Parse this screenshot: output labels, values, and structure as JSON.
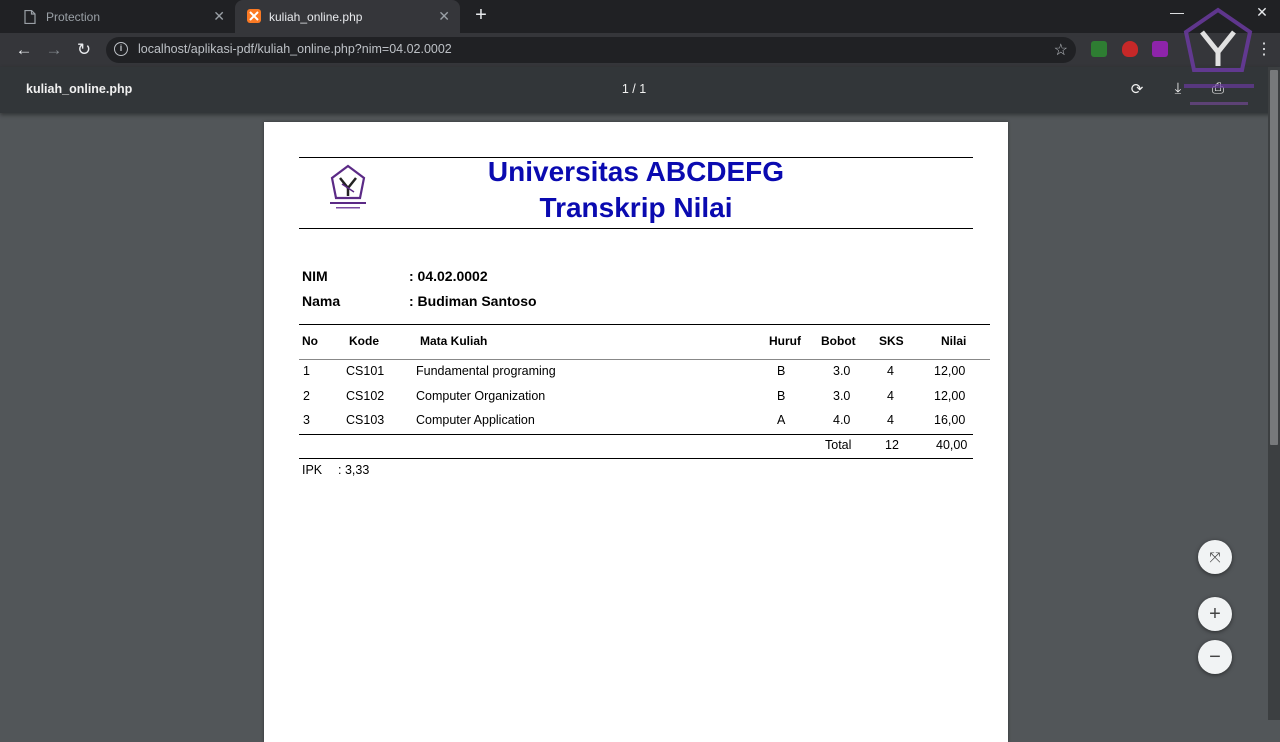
{
  "browser": {
    "tabs": [
      {
        "title": "Protection",
        "active": false
      },
      {
        "title": "kuliah_online.php",
        "active": true
      }
    ],
    "url": "localhost/aplikasi-pdf/kuliah_online.php?nim=04.02.0002"
  },
  "pdf_viewer": {
    "title": "kuliah_online.php",
    "page_indicator": "1 / 1"
  },
  "document": {
    "university": "Universitas ABCDEFG",
    "subtitle": "Transkrip Nilai",
    "student": [
      {
        "label": "NIM",
        "value": ": 04.02.0002"
      },
      {
        "label": "Nama",
        "value": ": Budiman Santoso"
      }
    ],
    "table": {
      "headers": [
        "No",
        "Kode",
        "Mata Kuliah",
        "Huruf",
        "Bobot",
        "SKS",
        "Nilai"
      ],
      "rows": [
        [
          "1",
          "CS101",
          "Fundamental programing",
          "B",
          "3.0",
          "4",
          "12,00"
        ],
        [
          "2",
          "CS102",
          "Computer Organization",
          "B",
          "3.0",
          "4",
          "12,00"
        ],
        [
          "3",
          "CS103",
          "Computer Application",
          "A",
          "4.0",
          "4",
          "16,00"
        ]
      ],
      "total": {
        "label": "Total",
        "sks": "12",
        "nilai": "40,00"
      }
    },
    "ipk": {
      "label": "IPK",
      "value": ": 3,33"
    }
  },
  "colors": {
    "title_blue": "#0a0ab0",
    "logo_purple": "#5b2a86"
  }
}
